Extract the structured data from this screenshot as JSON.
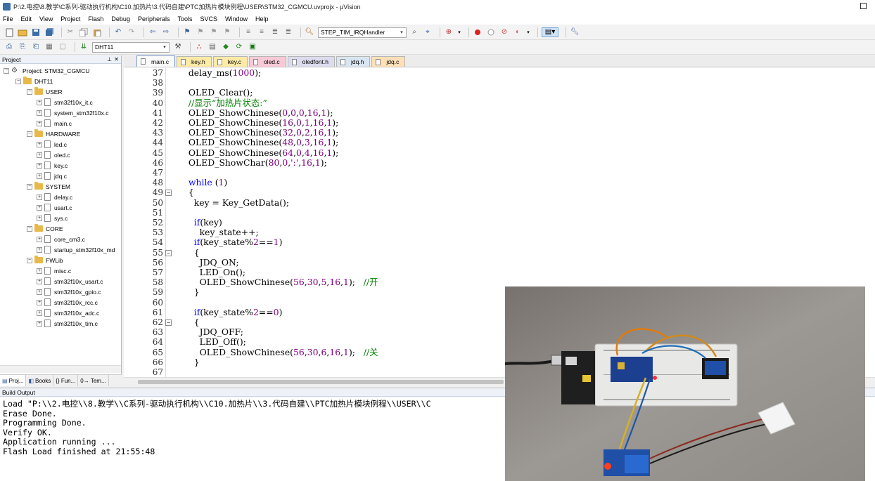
{
  "window": {
    "title": "P:\\2.电控\\8.教学\\C系列-驱动执行机构\\C10.加热片\\3.代码自建\\PTC加热片模块例程\\USER\\STM32_CGMCU.uvprojx - µVision"
  },
  "menu": [
    "File",
    "Edit",
    "View",
    "Project",
    "Flash",
    "Debug",
    "Peripherals",
    "Tools",
    "SVCS",
    "Window",
    "Help"
  ],
  "toolbar": {
    "find_combo": "STEP_TIM_IRQHandler",
    "target_combo": "DHT11"
  },
  "project_panel": {
    "title": "Project",
    "root": "Project: STM32_CGMCU",
    "target": "DHT11",
    "groups": [
      {
        "name": "USER",
        "files": [
          "stm32f10x_it.c",
          "system_stm32f10x.c",
          "main.c"
        ]
      },
      {
        "name": "HARDWARE",
        "files": [
          "led.c",
          "oled.c",
          "key.c",
          "jdq.c"
        ]
      },
      {
        "name": "SYSTEM",
        "files": [
          "delay.c",
          "usart.c",
          "sys.c"
        ]
      },
      {
        "name": "CORE",
        "files": [
          "core_cm3.c",
          "startup_stm32f10x_md"
        ]
      },
      {
        "name": "FWLib",
        "files": [
          "misc.c",
          "stm32f10x_usart.c",
          "stm32f10x_gpio.c",
          "stm32f10x_rcc.c",
          "stm32f10x_adc.c",
          "stm32f10x_tim.c"
        ]
      }
    ],
    "bottom_tabs": [
      "Proj...",
      "Books",
      "{} Fun...",
      "0→ Tem..."
    ]
  },
  "editor": {
    "tabs": [
      {
        "label": "main.c",
        "color": "#fafafa",
        "active": true
      },
      {
        "label": "key.h",
        "color": "#ffeaa6"
      },
      {
        "label": "key.c",
        "color": "#ffeaa6"
      },
      {
        "label": "oled.c",
        "color": "#f8c9d6"
      },
      {
        "label": "oledfont.h",
        "color": "#dcdcef"
      },
      {
        "label": "jdq.h",
        "color": "#d9e6f2"
      },
      {
        "label": "jdq.c",
        "color": "#ffe0b8"
      }
    ],
    "lines": [
      {
        "n": "37",
        "html": "  delay_ms(<span class=\"num\">1000</span>);"
      },
      {
        "n": "38",
        "html": ""
      },
      {
        "n": "39",
        "html": "  OLED_Clear();"
      },
      {
        "n": "40",
        "html": "  <span class=\"cm\">//显示“加热片状态:”</span>"
      },
      {
        "n": "41",
        "html": "  OLED_ShowChinese(<span class=\"num\">0</span>,<span class=\"num\">0</span>,<span class=\"num\">0</span>,<span class=\"num\">16</span>,<span class=\"num\">1</span>);"
      },
      {
        "n": "42",
        "html": "  OLED_ShowChinese(<span class=\"num\">16</span>,<span class=\"num\">0</span>,<span class=\"num\">1</span>,<span class=\"num\">16</span>,<span class=\"num\">1</span>);"
      },
      {
        "n": "43",
        "html": "  OLED_ShowChinese(<span class=\"num\">32</span>,<span class=\"num\">0</span>,<span class=\"num\">2</span>,<span class=\"num\">16</span>,<span class=\"num\">1</span>);"
      },
      {
        "n": "44",
        "html": "  OLED_ShowChinese(<span class=\"num\">48</span>,<span class=\"num\">0</span>,<span class=\"num\">3</span>,<span class=\"num\">16</span>,<span class=\"num\">1</span>);"
      },
      {
        "n": "45",
        "html": "  OLED_ShowChinese(<span class=\"num\">64</span>,<span class=\"num\">0</span>,<span class=\"num\">4</span>,<span class=\"num\">16</span>,<span class=\"num\">1</span>);"
      },
      {
        "n": "46",
        "html": "  OLED_ShowChar(<span class=\"num\">80</span>,<span class=\"num\">0</span>,<span class=\"ch\">':'</span>,<span class=\"num\">16</span>,<span class=\"num\">1</span>);"
      },
      {
        "n": "47",
        "html": ""
      },
      {
        "n": "48",
        "html": "  <span class=\"kw\">while</span> (<span class=\"num\">1</span>)"
      },
      {
        "n": "49",
        "html": "  {",
        "fold": true
      },
      {
        "n": "50",
        "html": "    key = Key_GetData();"
      },
      {
        "n": "51",
        "html": ""
      },
      {
        "n": "52",
        "html": "    <span class=\"kw\">if</span>(key)"
      },
      {
        "n": "53",
        "html": "      key_state++;"
      },
      {
        "n": "54",
        "html": "    <span class=\"kw\">if</span>(key_state%<span class=\"num\">2</span>==<span class=\"num\">1</span>)"
      },
      {
        "n": "55",
        "html": "    {",
        "fold": true
      },
      {
        "n": "56",
        "html": "      JDQ_ON;"
      },
      {
        "n": "57",
        "html": "      LED_On();"
      },
      {
        "n": "58",
        "html": "      OLED_ShowChinese(<span class=\"num\">56</span>,<span class=\"num\">30</span>,<span class=\"num\">5</span>,<span class=\"num\">16</span>,<span class=\"num\">1</span>);   <span class=\"cm\">//开</span>"
      },
      {
        "n": "59",
        "html": "    }"
      },
      {
        "n": "60",
        "html": ""
      },
      {
        "n": "61",
        "html": "    <span class=\"kw\">if</span>(key_state%<span class=\"num\">2</span>==<span class=\"num\">0</span>)"
      },
      {
        "n": "62",
        "html": "    {",
        "fold": true
      },
      {
        "n": "63",
        "html": "      JDQ_OFF;"
      },
      {
        "n": "64",
        "html": "      LED_Off();"
      },
      {
        "n": "65",
        "html": "      OLED_ShowChinese(<span class=\"num\">56</span>,<span class=\"num\">30</span>,<span class=\"num\">6</span>,<span class=\"num\">16</span>,<span class=\"num\">1</span>);   <span class=\"cm\">//关</span>"
      },
      {
        "n": "66",
        "html": "    }"
      },
      {
        "n": "67",
        "html": ""
      }
    ]
  },
  "build_output": {
    "title": "Build Output",
    "lines": [
      "Load \"P:\\\\2.电控\\\\8.教学\\\\C系列-驱动执行机构\\\\C10.加热片\\\\3.代码自建\\\\PTC加热片模块例程\\\\USER\\\\C",
      "Erase Done.",
      "Programming Done.",
      "Verify OK.",
      "Application running ...",
      "Flash Load finished at 21:55:48"
    ]
  }
}
